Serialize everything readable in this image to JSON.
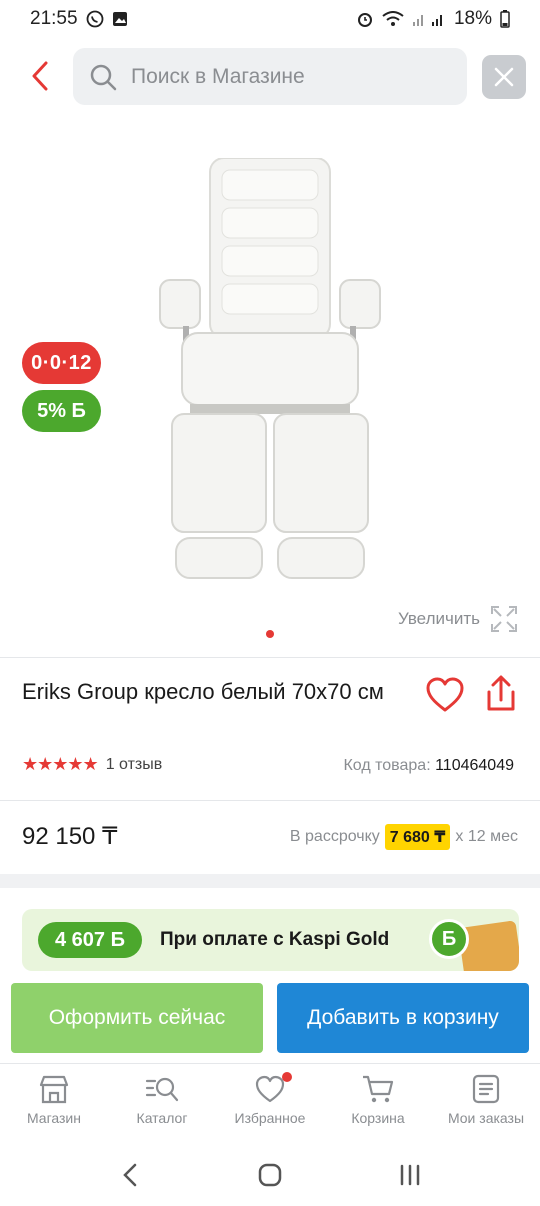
{
  "status_bar": {
    "time": "21:55",
    "battery": "18%"
  },
  "search": {
    "placeholder": "Поиск в Магазине"
  },
  "gallery": {
    "badge_installment": "0·0·12",
    "badge_bonus": "5% Б",
    "zoom_label": "Увеличить"
  },
  "product": {
    "title": "Eriks Group кресло белый 70x70 см",
    "stars": "★★★★★",
    "reviews": "1 отзыв",
    "code_label": "Код товара:",
    "code_value": "110464049",
    "price": "92 150 ₸",
    "installment_label": "В рассрочку",
    "installment_amount": "7 680 ₸",
    "installment_term": "x 12 мес"
  },
  "promo": {
    "bonus": "4 607 Б",
    "text": "При оплате с Kaspi Gold",
    "coin": "Б"
  },
  "actions": {
    "buy_now": "Оформить сейчас",
    "add_to_cart": "Добавить в корзину"
  },
  "bottom_nav": {
    "items": [
      {
        "label": "Магазин"
      },
      {
        "label": "Каталог"
      },
      {
        "label": "Избранное"
      },
      {
        "label": "Корзина"
      },
      {
        "label": "Мои заказы"
      }
    ]
  },
  "colors": {
    "accent_red": "#e53935",
    "bonus_green": "#4ca82d",
    "cart_blue": "#1f87d6",
    "buy_now_green": "#8fd16b",
    "installment_yellow": "#ffd400"
  }
}
